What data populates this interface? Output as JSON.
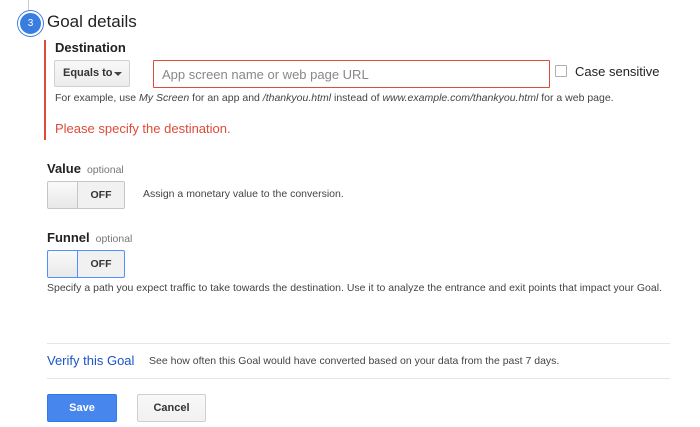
{
  "step": {
    "number": "3",
    "title": "Goal details"
  },
  "destination": {
    "label": "Destination",
    "match_type": "Equals to",
    "input_placeholder": "App screen name or web page URL",
    "input_value": "",
    "case_sensitive_label": "Case sensitive",
    "case_sensitive_checked": false,
    "example": {
      "part1": "For example, use ",
      "app_example": "My Screen",
      "part2": " for an app and ",
      "page_example": "/thankyou.html",
      "part3": " instead of ",
      "full_example": "www.example.com/thankyou.html",
      "part4": " for a web page."
    },
    "error": "Please specify the destination.",
    "error_color": "#dd4b39"
  },
  "value": {
    "label": "Value",
    "optional": "optional",
    "toggle_state": "OFF",
    "description": "Assign a monetary value to the conversion."
  },
  "funnel": {
    "label": "Funnel",
    "optional": "optional",
    "toggle_state": "OFF",
    "description": "Specify a path you expect traffic to take towards the destination. Use it to analyze the entrance and exit points that impact your Goal."
  },
  "verify": {
    "link": "Verify this Goal",
    "description": "See how often this Goal would have converted based on your data from the past 7 days."
  },
  "buttons": {
    "save": "Save",
    "cancel": "Cancel"
  },
  "colors": {
    "accent": "#3a7de0",
    "link": "#1a55c4",
    "primary_button": "#4787ed",
    "error": "#dd4b39"
  },
  "icons": {
    "step_badge": "step-number-circle",
    "match_dropdown": "caret-down-icon",
    "case_checkbox": "checkbox-unchecked"
  }
}
